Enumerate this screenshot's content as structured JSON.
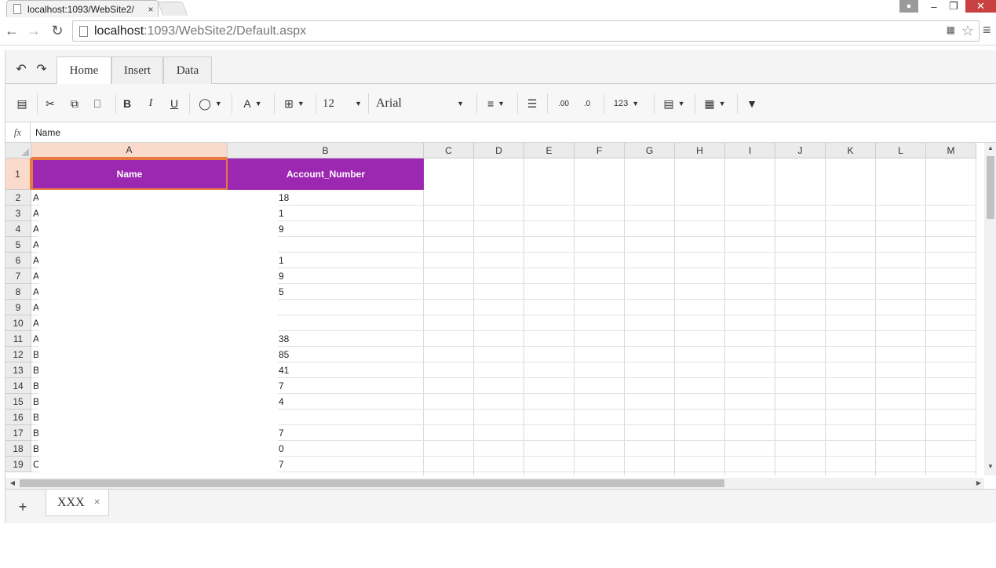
{
  "browser": {
    "tab_title": "localhost:1093/WebSite2/",
    "tab_close": "×",
    "address_host": "localhost",
    "address_path": ":1093/WebSite2/Default.aspx",
    "win_min": "–",
    "win_max": "❐",
    "win_close": "✕"
  },
  "ribbon": {
    "tabs": [
      "Home",
      "Insert",
      "Data"
    ],
    "active_tab": "Home",
    "font_size": "12",
    "font_name": "Arial",
    "number_format": "123"
  },
  "formula_bar": {
    "fx_label": "fx",
    "value": "Name"
  },
  "grid": {
    "columns": [
      "A",
      "B",
      "C",
      "D",
      "E",
      "F",
      "G",
      "H",
      "I",
      "J",
      "K",
      "L",
      "M"
    ],
    "selected_column": "A",
    "header_row": {
      "row": "1",
      "a": "Name",
      "b": "Account_Number"
    },
    "header_fill_color": "#9c27b0",
    "selection_color": "#e77a3f",
    "rows": [
      {
        "num": "2",
        "a": "A",
        "b": "18"
      },
      {
        "num": "3",
        "a": "A",
        "b": "1"
      },
      {
        "num": "4",
        "a": "A",
        "b": "9"
      },
      {
        "num": "5",
        "a": "A",
        "b": ""
      },
      {
        "num": "6",
        "a": "A",
        "b": "1"
      },
      {
        "num": "7",
        "a": "A",
        "b": "9"
      },
      {
        "num": "8",
        "a": "A",
        "b": "5"
      },
      {
        "num": "9",
        "a": "A",
        "b": ""
      },
      {
        "num": "10",
        "a": "A",
        "b": ""
      },
      {
        "num": "11",
        "a": "A",
        "b": "38"
      },
      {
        "num": "12",
        "a": "B",
        "b": "85"
      },
      {
        "num": "13",
        "a": "B",
        "b": "41"
      },
      {
        "num": "14",
        "a": "B",
        "b": "7"
      },
      {
        "num": "15",
        "a": "B",
        "b": "4"
      },
      {
        "num": "16",
        "a": "B",
        "b": ""
      },
      {
        "num": "17",
        "a": "B",
        "b": "7"
      },
      {
        "num": "18",
        "a": "B",
        "b": "0"
      },
      {
        "num": "19",
        "a": "C",
        "b": "7"
      }
    ]
  },
  "sheets": {
    "add_label": "+",
    "tabs": [
      {
        "name": "XXX",
        "close": "×"
      }
    ]
  }
}
